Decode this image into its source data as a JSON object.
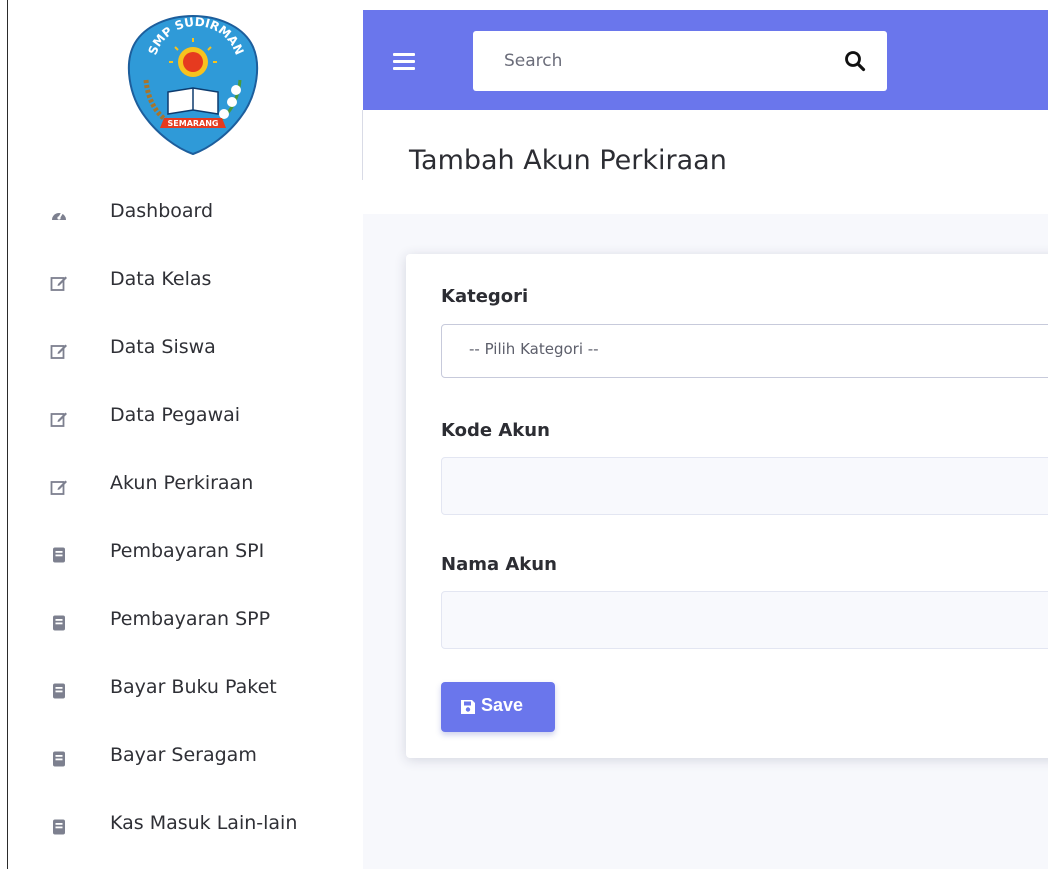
{
  "logo": {
    "top_text": "SMP SUDIRMAN",
    "bottom_text": "SEMARANG"
  },
  "sidebar": {
    "items": [
      {
        "label": "Dashboard",
        "icon": "dashboard-icon"
      },
      {
        "label": "Data Kelas",
        "icon": "edit-icon"
      },
      {
        "label": "Data Siswa",
        "icon": "edit-icon"
      },
      {
        "label": "Data Pegawai",
        "icon": "edit-icon"
      },
      {
        "label": "Akun Perkiraan",
        "icon": "edit-icon"
      },
      {
        "label": "Pembayaran SPI",
        "icon": "book-icon"
      },
      {
        "label": "Pembayaran SPP",
        "icon": "book-icon"
      },
      {
        "label": "Bayar Buku Paket",
        "icon": "book-icon"
      },
      {
        "label": "Bayar Seragam",
        "icon": "book-icon"
      },
      {
        "label": "Kas Masuk Lain-lain",
        "icon": "book-icon"
      }
    ]
  },
  "topbar": {
    "search_placeholder": "Search",
    "menu_icon": "hamburger-icon",
    "search_icon": "search-icon"
  },
  "page": {
    "title": "Tambah Akun Perkiraan"
  },
  "form": {
    "kategori_label": "Kategori",
    "kategori_selected": "-- Pilih Kategori --",
    "kode_label": "Kode Akun",
    "kode_value": "",
    "nama_label": "Nama Akun",
    "nama_value": "",
    "save_label": "Save",
    "save_icon": "floppy-disk-icon"
  },
  "colors": {
    "accent": "#6a76ec",
    "sidebar_icon": "#7d808f",
    "text": "#2c2d33"
  }
}
